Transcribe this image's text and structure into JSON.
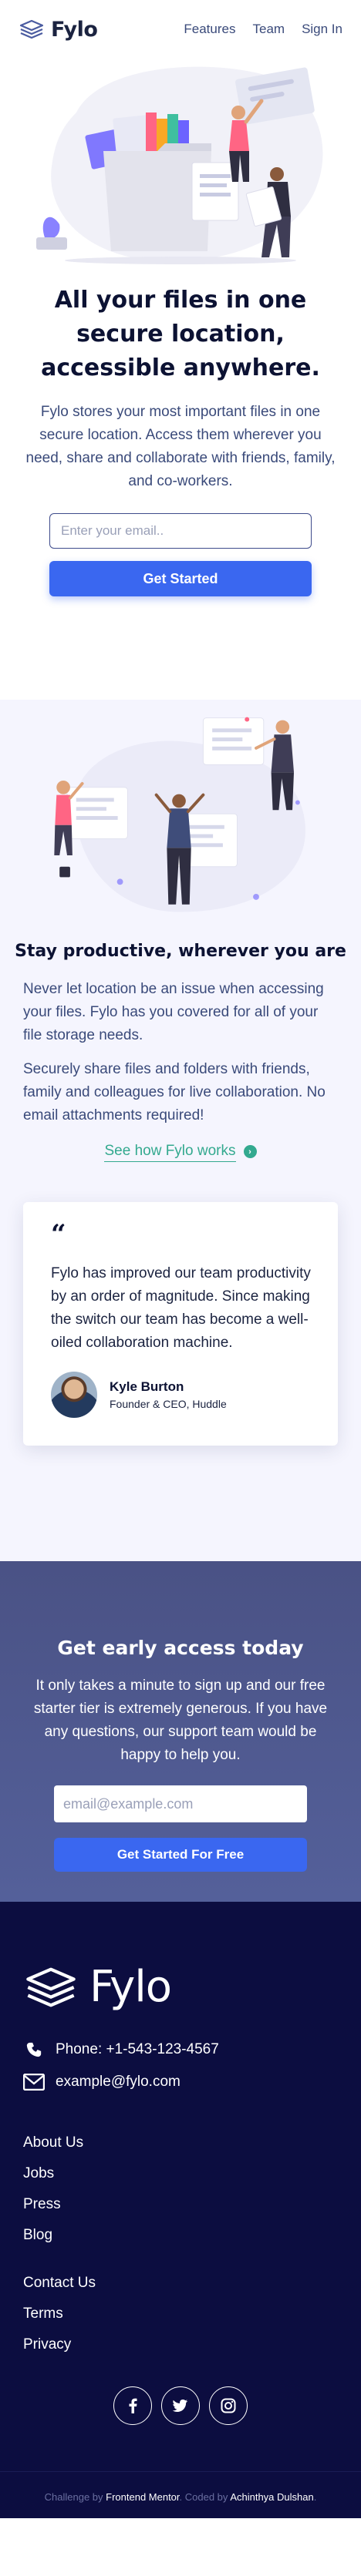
{
  "header": {
    "logo_text": "Fylo",
    "nav": [
      "Features",
      "Team",
      "Sign In"
    ]
  },
  "hero": {
    "title": "All your files in one secure location, accessible anywhere.",
    "text": "Fylo stores your most important files in one secure location. Access them wherever you need, share and collaborate with friends, family, and co-workers.",
    "email_placeholder": "Enter your email..",
    "button_label": "Get Started"
  },
  "productive": {
    "title": "Stay productive, wherever you are",
    "paragraph_1": "Never let location be an issue when accessing your files. Fylo has you covered for all of your file storage needs.",
    "paragraph_2": "Securely share files and folders with friends, family and colleagues for live collaboration. No email attachments required!",
    "link_label": "See how Fylo works",
    "testimonial": {
      "quote_mark": "“",
      "text": "Fylo has improved our team productivity by an order of magnitude. Since making the switch our team has become a well-oiled collaboration machine.",
      "author_name": "Kyle Burton",
      "author_role": "Founder & CEO, Huddle"
    }
  },
  "early_access": {
    "title": "Get early access today",
    "text": "It only takes a minute to sign up and our free starter tier is extremely generous. If you have any questions, our support team would be happy to help you.",
    "email_placeholder": "email@example.com",
    "button_label": "Get Started For Free"
  },
  "footer": {
    "logo_text": "Fylo",
    "phone": "Phone: +1-543-123-4567",
    "email": "example@fylo.com",
    "links_1": [
      "About Us",
      "Jobs",
      "Press",
      "Blog"
    ],
    "links_2": [
      "Contact Us",
      "Terms",
      "Privacy"
    ],
    "social": [
      "facebook-icon",
      "twitter-icon",
      "instagram-icon"
    ],
    "attribution": {
      "prefix": "Challenge by ",
      "challenge_by": "Frontend Mentor",
      "middle": ". Coded by ",
      "coded_by": "Achinthya Dulshan",
      "suffix": "."
    }
  },
  "colors": {
    "primary_blue": "#3a67f0",
    "accent_teal": "#33a98f",
    "dark_navy": "#0c0d40",
    "early_access_bg": "#4f5c93",
    "section_bg": "#f5f5fe"
  }
}
